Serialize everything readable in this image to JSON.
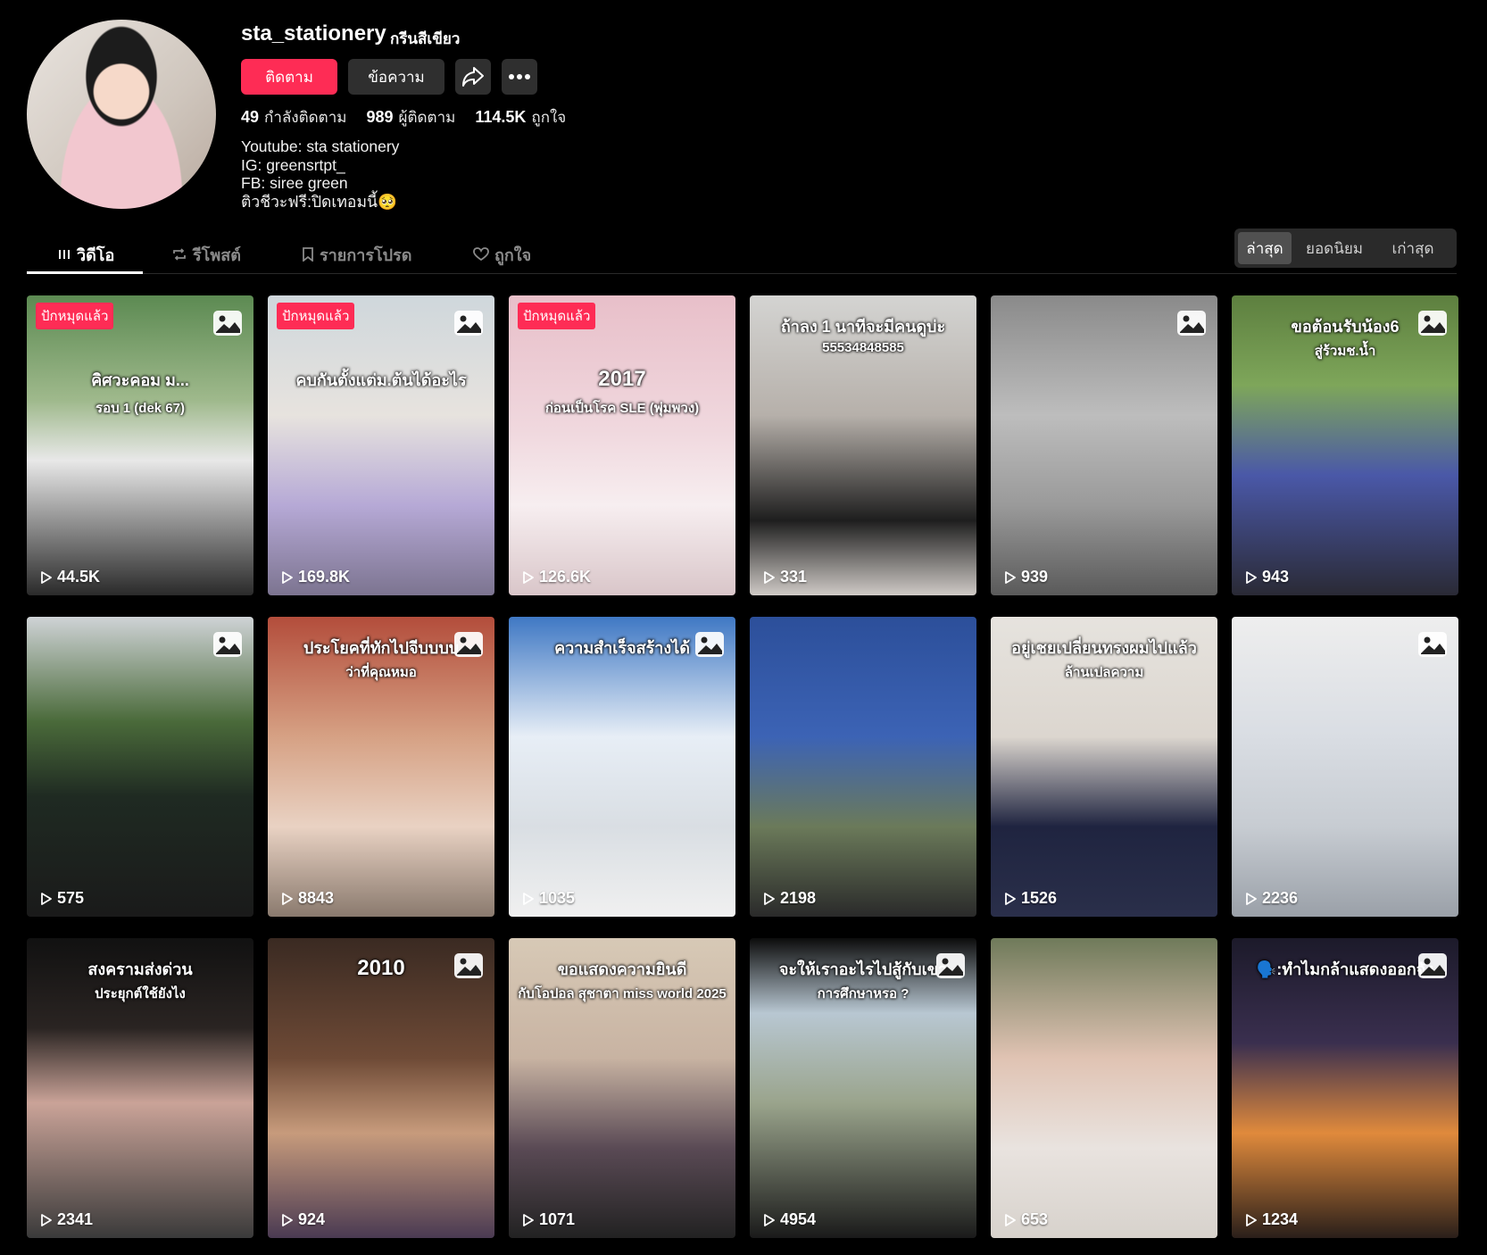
{
  "profile": {
    "username": "sta_stationery",
    "nickname": "กรีนสีเขียว",
    "follow_label": "ติดตาม",
    "message_label": "ข้อความ",
    "following_count": "49",
    "following_label": "กำลังติดตาม",
    "followers_count": "989",
    "followers_label": "ผู้ติดตาม",
    "likes_count": "114.5K",
    "likes_label": "ถูกใจ",
    "bio": [
      "Youtube: sta stationery",
      "IG: greensrtpt_",
      "FB: siree green",
      "ติวชีวะฟรี:ปิดเทอมนี้🥺"
    ]
  },
  "tabs": [
    {
      "label": "วิดีโอ",
      "icon": "grid-icon"
    },
    {
      "label": "รีโพสต์",
      "icon": "repost-icon"
    },
    {
      "label": "รายการโปรด",
      "icon": "bookmark-icon"
    },
    {
      "label": "ถูกใจ",
      "icon": "heart-icon"
    }
  ],
  "sort": {
    "latest": "ล่าสุด",
    "popular": "ยอดนิยม",
    "oldest": "เก่าสุด"
  },
  "pinned_label": "ปักหมุดแล้ว",
  "videos": [
    {
      "views": "44.5K",
      "pinned": true,
      "photo": true,
      "overlay": "คิศวะคอม ม...",
      "overlay2": "รอบ 1 (dek 67)"
    },
    {
      "views": "169.8K",
      "pinned": true,
      "photo": true,
      "overlay": "คบกันตั้งแต่ม.ต้นได้อะไร"
    },
    {
      "views": "126.6K",
      "pinned": true,
      "photo": false,
      "overlay": "2017",
      "overlay2": "ก่อนเป็นโรค SLE (พุ่มพวง)"
    },
    {
      "views": "331",
      "pinned": false,
      "photo": false,
      "overlay": "ถ้าลง 1 นาทีจะมีคนดูบ่ะ",
      "overlay2": "55534848585"
    },
    {
      "views": "939",
      "pinned": false,
      "photo": true,
      "overlay": ""
    },
    {
      "views": "943",
      "pinned": false,
      "photo": true,
      "overlay": "ขอต้อนรับน้อง6",
      "overlay2": "สู่ร้วมช.น้ำ"
    },
    {
      "views": "575",
      "pinned": false,
      "photo": true,
      "overlay": ""
    },
    {
      "views": "8843",
      "pinned": false,
      "photo": true,
      "overlay": "ประโยคที่ทักไปจีบบบบ",
      "overlay2": "ว่าที่คุณหมอ"
    },
    {
      "views": "1035",
      "pinned": false,
      "photo": true,
      "overlay": "ความสำเร็จสร้างได้"
    },
    {
      "views": "2198",
      "pinned": false,
      "photo": false,
      "overlay": ""
    },
    {
      "views": "1526",
      "pinned": false,
      "photo": false,
      "overlay": "อยู่เชยเปลี่ยนทรงผมไปแล้ว",
      "overlay2": "ล้านเปลความ"
    },
    {
      "views": "2236",
      "pinned": false,
      "photo": true,
      "overlay": ""
    },
    {
      "views": "2341",
      "pinned": false,
      "photo": false,
      "overlay": "สงครามส่งด่วน",
      "overlay2": "ประยุกต์ใช้ยังไง"
    },
    {
      "views": "924",
      "pinned": false,
      "photo": true,
      "overlay": "2010"
    },
    {
      "views": "1071",
      "pinned": false,
      "photo": false,
      "overlay": "ขอแสดงความยินดี",
      "overlay2": "กับโอปอล สุชาตา miss world 2025"
    },
    {
      "views": "4954",
      "pinned": false,
      "photo": true,
      "overlay": "จะให้เราอะไรไปสู้กับเขา",
      "overlay2": "การศึกษาหรอ ?"
    },
    {
      "views": "653",
      "pinned": false,
      "photo": false,
      "overlay": ""
    },
    {
      "views": "1234",
      "pinned": false,
      "photo": true,
      "overlay": "🗣️:ทำไมกล้าแสดงออกจัง"
    }
  ],
  "colors": {
    "accent": "#fe2c55",
    "button_dark": "#2f2f2f",
    "background": "#000000"
  }
}
